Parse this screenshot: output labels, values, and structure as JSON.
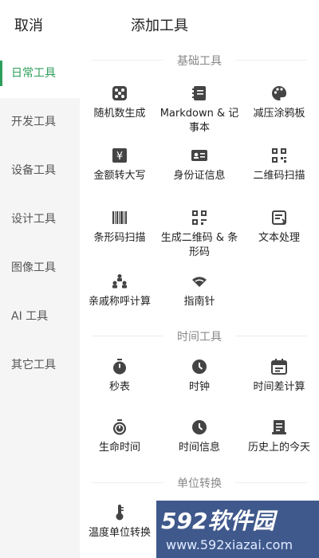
{
  "header": {
    "cancel_label": "取消",
    "title": "添加工具"
  },
  "sidebar": {
    "items": [
      {
        "label": "日常工具",
        "active": true
      },
      {
        "label": "开发工具",
        "active": false
      },
      {
        "label": "设备工具",
        "active": false
      },
      {
        "label": "设计工具",
        "active": false
      },
      {
        "label": "图像工具",
        "active": false
      },
      {
        "label": "AI 工具",
        "active": false
      },
      {
        "label": "其它工具",
        "active": false
      }
    ]
  },
  "sections": [
    {
      "title": "基础工具",
      "tools": [
        {
          "label": "随机数生成",
          "icon": "dice-icon"
        },
        {
          "label": "Markdown & 记事本",
          "icon": "notebook-icon"
        },
        {
          "label": "减压涂鸦板",
          "icon": "palette-icon"
        },
        {
          "label": "金额转大写",
          "icon": "yuan-icon"
        },
        {
          "label": "身份证信息",
          "icon": "id-card-icon"
        },
        {
          "label": "二维码扫描",
          "icon": "qr-code-icon"
        },
        {
          "label": "条形码扫描",
          "icon": "barcode-icon"
        },
        {
          "label": "生成二维码 & 条形码",
          "icon": "qr-generate-icon"
        },
        {
          "label": "文本处理",
          "icon": "text-process-icon"
        },
        {
          "label": "亲戚称呼计算",
          "icon": "family-tree-icon"
        },
        {
          "label": "指南针",
          "icon": "compass-icon"
        }
      ]
    },
    {
      "title": "时间工具",
      "tools": [
        {
          "label": "秒表",
          "icon": "stopwatch-icon"
        },
        {
          "label": "时钟",
          "icon": "clock-icon"
        },
        {
          "label": "时间差计算",
          "icon": "calendar-icon"
        },
        {
          "label": "生命时间",
          "icon": "life-timer-icon"
        },
        {
          "label": "时间信息",
          "icon": "clock-info-icon"
        },
        {
          "label": "历史上的今天",
          "icon": "history-icon"
        }
      ]
    },
    {
      "title": "单位转换",
      "tools": [
        {
          "label": "温度单位转换",
          "icon": "thermometer-icon"
        }
      ]
    }
  ],
  "watermark": {
    "logo": "592软件园",
    "url": "www.592xiazai.com"
  },
  "colors": {
    "accent": "#2e9e5b",
    "sidebar_bg": "#f5f5f5",
    "icon": "#444444"
  }
}
